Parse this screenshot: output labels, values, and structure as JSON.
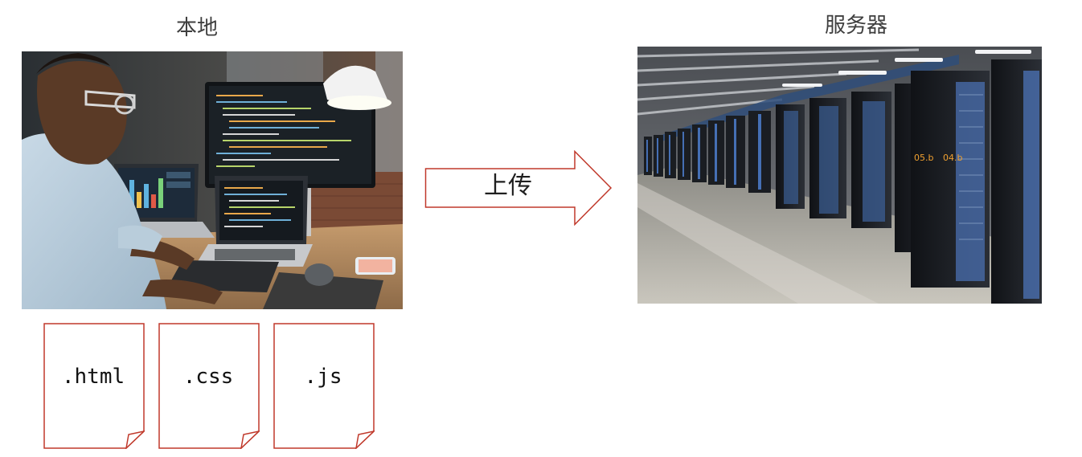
{
  "local": {
    "title": "本地",
    "photo_icon": "developer-workstation-photo"
  },
  "server": {
    "title": "服务器",
    "photo_icon": "server-room-photo",
    "rack_labels": [
      "05.b",
      "04.b"
    ]
  },
  "arrow": {
    "label": "上传",
    "border_color": "#c0392b"
  },
  "files": [
    {
      "label": ".html"
    },
    {
      "label": ".css"
    },
    {
      "label": ".js"
    }
  ],
  "colors": {
    "outline_red": "#c0392b",
    "title_text": "#3f3f3f"
  }
}
